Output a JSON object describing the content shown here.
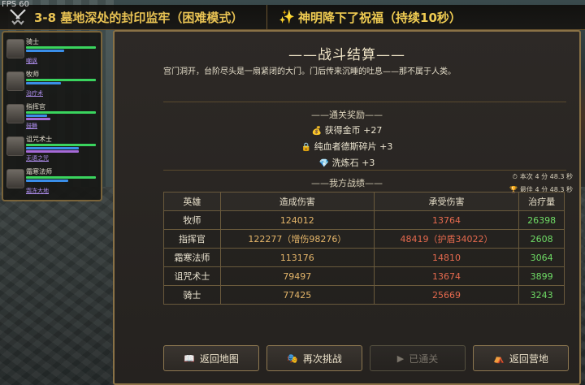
{
  "fps": "FPS 60",
  "topbar": {
    "stage_title": "3-8 墓地深处的封印监牢（困难模式）",
    "blessing": "神明降下了祝福（持续10秒）",
    "stage_icon": "crossed-swords-icon",
    "blessing_icon": "sparkle-icon"
  },
  "party": [
    {
      "name": "骑士",
      "skill": "嘲讽",
      "hp": 1.0,
      "mp": 0.55,
      "xp": 0.0
    },
    {
      "name": "牧师",
      "skill": "治疗术",
      "hp": 1.0,
      "mp": 0.5,
      "xp": 0.0
    },
    {
      "name": "指挥官",
      "skill": "鼓舞",
      "hp": 1.0,
      "mp": 0.3,
      "xp": 0.35
    },
    {
      "name": "诅咒术士",
      "skill": "无语之咒",
      "hp": 1.0,
      "mp": 0.75,
      "xp": 0.75
    },
    {
      "name": "霜寒法师",
      "skill": "霜冻大地",
      "hp": 1.0,
      "mp": 0.6,
      "xp": 0.0
    }
  ],
  "result": {
    "title": "——战斗结算——",
    "description": "宫门洞开，台阶尽头是一扇紧闭的大门。门后传来沉睡的吐息——那不属于人类。",
    "rewards_title": "——通关奖励——",
    "rewards": [
      {
        "icon": "coin-bag-icon",
        "text": "获得金币 +27"
      },
      {
        "icon": "lock-icon",
        "text": "纯血者德斯碎片 +3"
      },
      {
        "icon": "gem-icon",
        "text": "洗炼石 +3"
      }
    ],
    "stats_title": "——我方战绩——",
    "time_current": "本次 4 分 48.3 秒",
    "time_best": "最佳 4 分 48.3 秒",
    "columns": [
      "英雄",
      "造成伤害",
      "承受伤害",
      "治疗量"
    ],
    "rows": [
      [
        "牧师",
        "124012",
        "13764",
        "26398"
      ],
      [
        "指挥官",
        "122277（增伤98276）",
        "48419（护盾34022）",
        "2608"
      ],
      [
        "霜寒法师",
        "113176",
        "14810",
        "3064"
      ],
      [
        "诅咒术士",
        "79497",
        "13674",
        "3899"
      ],
      [
        "骑士",
        "77425",
        "25669",
        "3243"
      ]
    ]
  },
  "buttons": {
    "back_map": "返回地图",
    "retry": "再次挑战",
    "cleared": "已通关",
    "back_camp": "返回营地"
  }
}
